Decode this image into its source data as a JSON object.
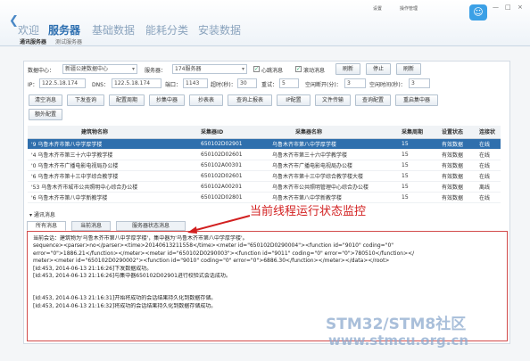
{
  "header": {
    "nav_tabs": [
      "欢迎",
      "服务器",
      "基础数据",
      "能耗分类",
      "安装数据"
    ],
    "sub_tabs": [
      "通讯服务器",
      "测试服务器"
    ],
    "tray": [
      "设置",
      "操作管理"
    ],
    "window_controls": [
      "—",
      "□",
      "×"
    ],
    "logo_glyph": "☺"
  },
  "controls": {
    "datacenter_label": "数据中心：",
    "datacenter_value": "新疆公建数据中心",
    "server_label": "服务器：",
    "server_value": "174服务器",
    "heartbeat_label": "心跳消息",
    "scroll_label": "滚动消息",
    "refresh_button": "刷新",
    "stop_button": "停止",
    "clear_button": "刷新",
    "ip_label": "IP：",
    "ip_value": "122.5.18.174",
    "dns_label": "DNS：",
    "dns_value": "122.5.18.174",
    "port_label": "端口：",
    "port_value": "1143",
    "timeout_label": "超时(秒)：",
    "timeout_value": "30",
    "retry_label": "重试：",
    "retry_value": "5",
    "reconnect_label": "空闲断开(分)：",
    "reconnect_value": "3",
    "idle_label": "空闲时间(秒)：",
    "idle_value": "3"
  },
  "toolbar": [
    "清空消息",
    "下发查询",
    "配置周期",
    "抄集中器",
    "抄表表",
    "查询上报表",
    "IP配置",
    "文件传输",
    "查询配置",
    "重启集中器",
    "额外配置"
  ],
  "grid": {
    "headers": [
      "建筑物名称",
      "采集器ID",
      "采集器名称",
      "采集周期",
      "设置状态",
      "连接状"
    ],
    "rows": [
      [
        "'9  乌鲁木齐市第八中学厚学楼",
        "650102D02901",
        "乌鲁木齐市第八中学厚学楼",
        "15",
        "有效数据",
        "在线"
      ],
      [
        "'4  乌鲁木齐市第三十六中学教学楼",
        "650102D02601",
        "乌鲁木齐市第三十六中学教学楼",
        "15",
        "有效数据",
        "在线"
      ],
      [
        "'0  乌鲁木齐市广播电影电视局办公楼",
        "650102A00301",
        "乌鲁木齐市广播电影电视局办公楼",
        "15",
        "有效数据",
        "在线"
      ],
      [
        "'6  乌鲁木齐市第十三中学综合教学楼",
        "650102D02601",
        "乌鲁木齐市第十三中学综合教学楼大楼",
        "15",
        "有效数据",
        "在线"
      ],
      [
        "'53  乌鲁木齐市城市公共照明中心综合办公楼",
        "650102A00201",
        "乌鲁木齐市公共照明管理中心综合办公楼",
        "15",
        "有效数据",
        "离线"
      ],
      [
        "'6  乌鲁木齐市第八中学新教学楼",
        "650102D02801",
        "乌鲁木齐市第八中学新教学楼",
        "15",
        "有效数据",
        "在线"
      ]
    ]
  },
  "messages": {
    "section_title": "通讯消息",
    "tabs": [
      "所有消息",
      "当前消息",
      "服务器状态消息"
    ],
    "callout": "当前线程运行状态监控",
    "lines": [
      "当前会话：建筑物为'乌鲁木齐市第八中学厚学楼'，集中器为'乌鲁木齐市第八中学厚学楼'。",
      "sequence><parser>no</parser><time>20140613211558</time><meter id=\"650102D0290004\"><function id=\"9010\" coding=\"0\"",
      "error=\"0\">1886.21</function></meter><meter id=\"650102D0290003\"><function id=\"9011\" coding=\"0\" error=\"0\">780510</function></",
      "meter><meter id=\"650102D0290002\"><function id=\"9010\" coding=\"0\" error=\"0\">6886.30</function></meter></data></root>",
      "[Id:453, 2014-06-13 21:16:26]下发数据成功。",
      "[Id:453, 2014-06-13 21:16:26]与集中器650102D02901进行校验式会话成功。",
      "",
      "",
      "[Id:453, 2014-06-13 21:16:31]开始将成功的会话结果持久化到数据存储。",
      "[Id:453, 2014-06-13 21:16:32]将成功的会话结果持久化到数据存储成功。"
    ]
  },
  "watermark": {
    "line1": "STM32/STM8社区",
    "line2": "www.stmcu.org.cn"
  },
  "colors": {
    "accent": "#2f6fad",
    "callout": "#d21f1f"
  }
}
